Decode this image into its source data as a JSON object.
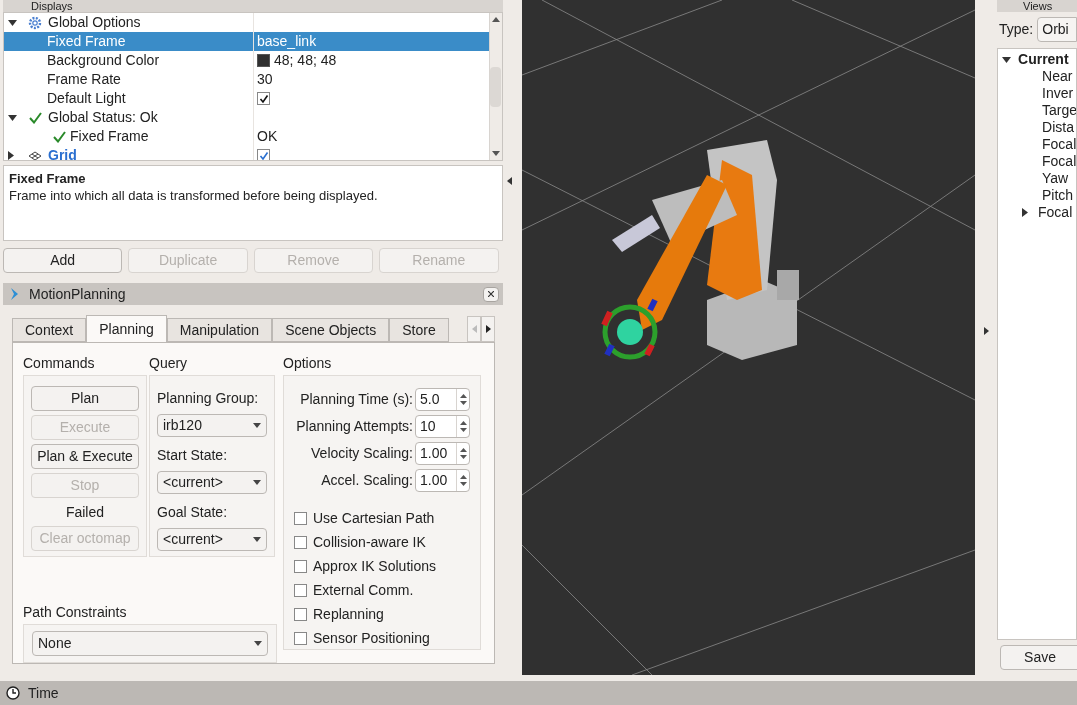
{
  "displays": {
    "title": "Displays",
    "tree": [
      {
        "label": "Global Options",
        "kind": "options",
        "expanded": true,
        "selected": false,
        "children": [
          {
            "label": "Fixed Frame",
            "kind": "text",
            "value": "base_link",
            "selected": true
          },
          {
            "label": "Background Color",
            "kind": "color",
            "value": "48; 48; 48",
            "color": "#303030",
            "selected": false
          },
          {
            "label": "Frame Rate",
            "kind": "text",
            "value": "30",
            "selected": false
          },
          {
            "label": "Default Light",
            "kind": "checkbox",
            "checked": true,
            "selected": false
          }
        ]
      },
      {
        "label": "Global Status: Ok",
        "kind": "status",
        "expanded": true,
        "selected": false,
        "children": [
          {
            "label": "Fixed Frame",
            "kind": "status",
            "value": "OK",
            "selected": false
          }
        ]
      },
      {
        "label": "Grid",
        "kind": "display",
        "expanded": false,
        "checked": true,
        "selected": false
      }
    ],
    "description": {
      "title": "Fixed Frame",
      "text": "Frame into which all data is transformed before being displayed."
    },
    "buttons": [
      {
        "label": "Add",
        "disabled": false
      },
      {
        "label": "Duplicate",
        "disabled": true
      },
      {
        "label": "Remove",
        "disabled": true
      },
      {
        "label": "Rename",
        "disabled": true
      }
    ]
  },
  "motion_planning": {
    "title": "MotionPlanning",
    "tabs": [
      {
        "label": "Context",
        "selected": false
      },
      {
        "label": "Planning",
        "selected": true
      },
      {
        "label": "Manipulation",
        "selected": false
      },
      {
        "label": "Scene Objects",
        "selected": false
      },
      {
        "label": "Store",
        "selected": false
      }
    ],
    "commands": {
      "title": "Commands",
      "buttons": [
        {
          "label": "Plan",
          "disabled": false
        },
        {
          "label": "Execute",
          "disabled": true
        },
        {
          "label": "Plan & Execute",
          "disabled": false
        },
        {
          "label": "Stop",
          "disabled": true
        }
      ],
      "status": "Failed",
      "clear_button": {
        "label": "Clear octomap",
        "disabled": true
      }
    },
    "query": {
      "title": "Query",
      "fields": [
        {
          "label": "Planning Group:",
          "value": "irb120"
        },
        {
          "label": "Start State:",
          "value": "<current>"
        },
        {
          "label": "Goal State:",
          "value": "<current>"
        }
      ]
    },
    "path_constraints": {
      "title": "Path Constraints",
      "value": "None"
    },
    "options": {
      "title": "Options",
      "spinboxes": [
        {
          "label": "Planning Time (s):",
          "value": "5.0"
        },
        {
          "label": "Planning Attempts:",
          "value": "10"
        },
        {
          "label": "Velocity Scaling:",
          "value": "1.00"
        },
        {
          "label": "Accel. Scaling:",
          "value": "1.00"
        }
      ],
      "checkboxes": [
        {
          "label": "Use Cartesian Path",
          "checked": false
        },
        {
          "label": "Collision-aware IK",
          "checked": false
        },
        {
          "label": "Approx IK Solutions",
          "checked": false
        },
        {
          "label": "External Comm.",
          "checked": false
        },
        {
          "label": "Replanning",
          "checked": false
        },
        {
          "label": "Sensor Positioning",
          "checked": false
        }
      ]
    }
  },
  "views": {
    "title": "Views",
    "type_label": "Type:",
    "type_value": "Orbi",
    "tree": [
      {
        "label": "Current",
        "expanded": true,
        "children": [
          {
            "label": "Near"
          },
          {
            "label": "Inver"
          },
          {
            "label": "Targe"
          },
          {
            "label": "Dista"
          },
          {
            "label": "Focal"
          },
          {
            "label": "Focal"
          },
          {
            "label": "Yaw"
          },
          {
            "label": "Pitch"
          },
          {
            "label": "Focal",
            "expanded": false
          }
        ]
      }
    ],
    "save_button": "Save"
  },
  "time_panel": {
    "title": "Time"
  }
}
